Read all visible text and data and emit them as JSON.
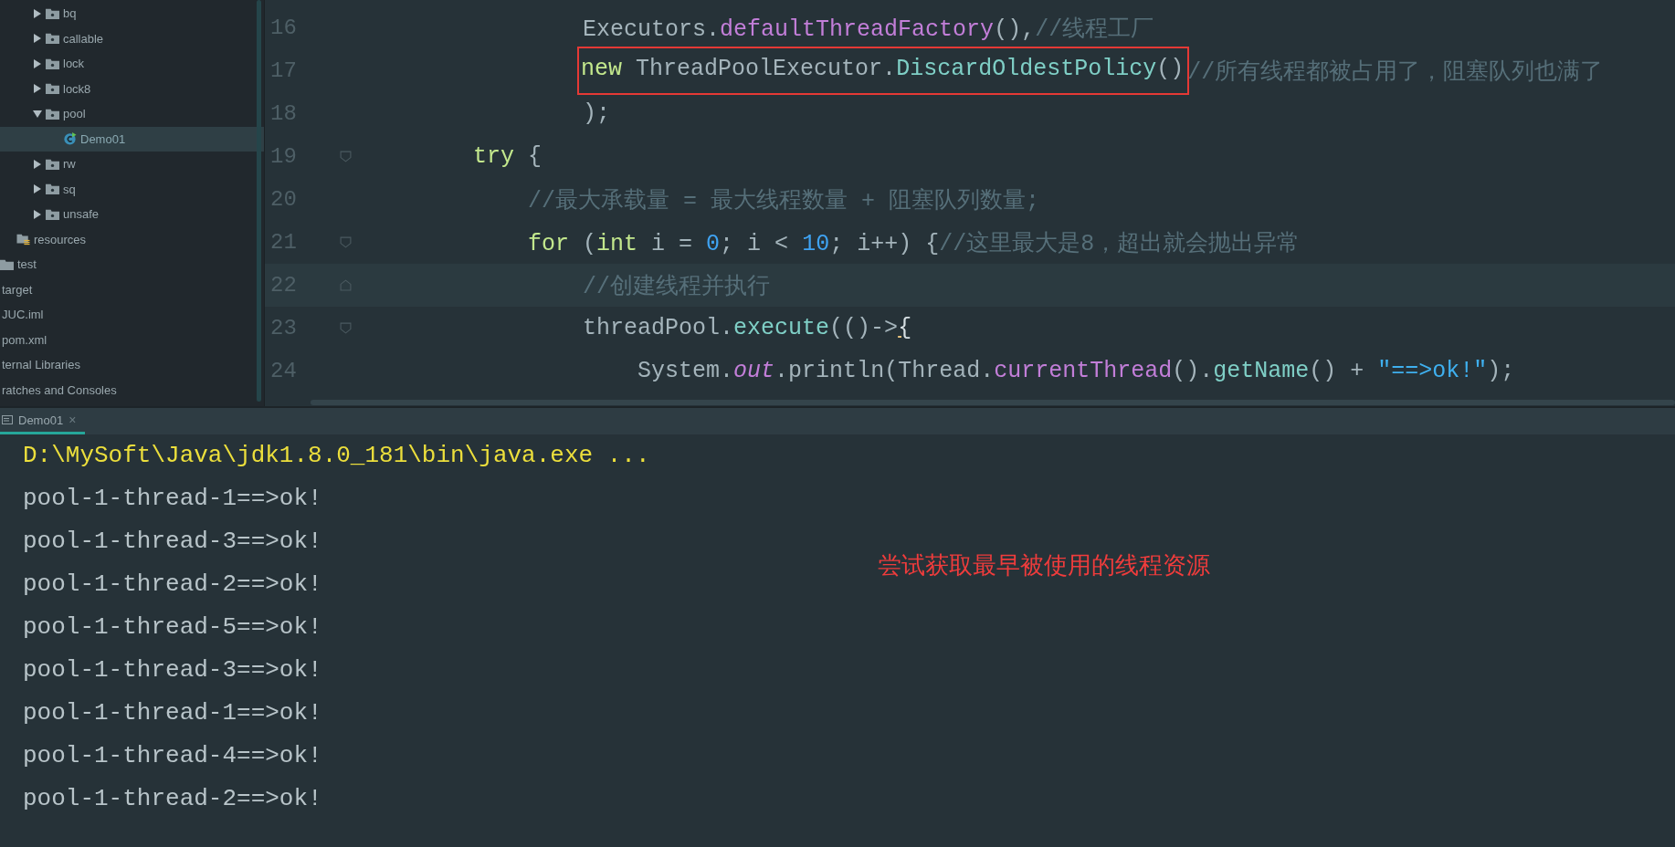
{
  "sidebar": {
    "tree": [
      {
        "label": "bq",
        "kind": "package",
        "expanded": false,
        "selected": false
      },
      {
        "label": "callable",
        "kind": "package",
        "expanded": false,
        "selected": false
      },
      {
        "label": "lock",
        "kind": "package",
        "expanded": false,
        "selected": false
      },
      {
        "label": "lock8",
        "kind": "package",
        "expanded": false,
        "selected": false
      },
      {
        "label": "pool",
        "kind": "package",
        "expanded": true,
        "selected": false,
        "children": [
          {
            "label": "Demo01",
            "kind": "class",
            "selected": true
          }
        ]
      },
      {
        "label": "rw",
        "kind": "package",
        "expanded": false,
        "selected": false
      },
      {
        "label": "sq",
        "kind": "package",
        "expanded": false,
        "selected": false
      },
      {
        "label": "unsafe",
        "kind": "package",
        "expanded": false,
        "selected": false
      },
      {
        "label": "resources",
        "kind": "resources",
        "selected": false
      },
      {
        "label": "test",
        "kind": "folder",
        "selected": false
      },
      {
        "label": "target",
        "kind": "plain",
        "selected": false
      },
      {
        "label": "JUC.iml",
        "kind": "plain",
        "selected": false
      },
      {
        "label": "pom.xml",
        "kind": "plain",
        "selected": false
      },
      {
        "label": "ternal Libraries",
        "kind": "plain",
        "selected": false
      },
      {
        "label": "ratches and Consoles",
        "kind": "plain",
        "selected": false
      }
    ]
  },
  "editor": {
    "lines": [
      {
        "number": "16",
        "kind": "continuation",
        "tokens": [
          {
            "text": "Executors.",
            "kind": "plain"
          },
          {
            "text": "defaultThreadFactory",
            "kind": "call"
          },
          {
            "text": "(),",
            "kind": "plain"
          },
          {
            "text": "//线程工厂",
            "kind": "comment"
          }
        ]
      },
      {
        "number": "17",
        "kind": "continuation",
        "marked": [
          {
            "text": "new",
            "kind": "keyword"
          },
          {
            "text": " ThreadPoolExecutor.",
            "kind": "plain"
          },
          {
            "text": "DiscardOldestPolicy",
            "kind": "method"
          },
          {
            "text": "()",
            "kind": "plain"
          }
        ],
        "tokens": [
          {
            "text": "//所有线程都被占用了，阻塞队列也满了",
            "kind": "comment"
          }
        ]
      },
      {
        "number": "18",
        "kind": "continuation",
        "tokens": [
          {
            "text": ");",
            "kind": "plain"
          }
        ]
      },
      {
        "number": "19",
        "kind": "statement",
        "fold_open": true,
        "tokens": [
          {
            "text": "try",
            "kind": "keyword"
          },
          {
            "text": " {",
            "kind": "plain"
          }
        ],
        "children": [
          {
            "number": "20",
            "kind": "statement",
            "tokens": [
              {
                "text": "//最大承载量 = 最大线程数量 + 阻塞队列数量;",
                "kind": "comment"
              }
            ]
          },
          {
            "number": "21",
            "kind": "statement",
            "fold_open": true,
            "tokens": [
              {
                "text": "for",
                "kind": "keyword"
              },
              {
                "text": " (",
                "kind": "plain"
              },
              {
                "text": "int",
                "kind": "keyword"
              },
              {
                "text": " i = ",
                "kind": "plain"
              },
              {
                "text": "0",
                "kind": "number"
              },
              {
                "text": "; i < ",
                "kind": "plain"
              },
              {
                "text": "10",
                "kind": "number"
              },
              {
                "text": "; i++) {",
                "kind": "plain"
              },
              {
                "text": "//这里最大是8，超出就会抛出异常",
                "kind": "comment"
              }
            ],
            "children": [
              {
                "number": "22",
                "kind": "statement",
                "fold_close": true,
                "current": true,
                "tokens": [
                  {
                    "text": "//创建线程并执行",
                    "kind": "comment"
                  }
                ]
              },
              {
                "number": "23",
                "kind": "statement",
                "fold_open": true,
                "tokens": [
                  {
                    "text": "threadPool.",
                    "kind": "plain"
                  },
                  {
                    "text": "execute",
                    "kind": "method"
                  },
                  {
                    "text": "(()->",
                    "kind": "plain"
                  },
                  {
                    "text": "{",
                    "kind": "brace"
                  }
                ],
                "children": [
                  {
                    "number": "24",
                    "kind": "statement",
                    "tokens": [
                      {
                        "text": "System.",
                        "kind": "plain"
                      },
                      {
                        "text": "out",
                        "kind": "field"
                      },
                      {
                        "text": ".println(Thread.",
                        "kind": "plain"
                      },
                      {
                        "text": "currentThread",
                        "kind": "call"
                      },
                      {
                        "text": "().",
                        "kind": "plain"
                      },
                      {
                        "text": "getName",
                        "kind": "method"
                      },
                      {
                        "text": "() + ",
                        "kind": "plain"
                      },
                      {
                        "text": "\"==>ok!\"",
                        "kind": "string"
                      },
                      {
                        "text": ");",
                        "kind": "plain"
                      }
                    ]
                  }
                ]
              }
            ]
          }
        ]
      }
    ]
  },
  "console": {
    "tab": {
      "label": "Demo01",
      "close": "×",
      "selected": true
    },
    "lines": [
      {
        "text": "D:\\MySoft\\Java\\jdk1.8.0_181\\bin\\java.exe ...",
        "kind": "command"
      },
      {
        "text": "pool-1-thread-1==>ok!",
        "kind": "output"
      },
      {
        "text": "pool-1-thread-3==>ok!",
        "kind": "output"
      },
      {
        "text": "pool-1-thread-2==>ok!",
        "kind": "output"
      },
      {
        "text": "pool-1-thread-5==>ok!",
        "kind": "output"
      },
      {
        "text": "pool-1-thread-3==>ok!",
        "kind": "output"
      },
      {
        "text": "pool-1-thread-1==>ok!",
        "kind": "output"
      },
      {
        "text": "pool-1-thread-4==>ok!",
        "kind": "output"
      },
      {
        "text": "pool-1-thread-2==>ok!",
        "kind": "output"
      }
    ],
    "annotation": "尝试获取最早被使用的线程资源"
  }
}
